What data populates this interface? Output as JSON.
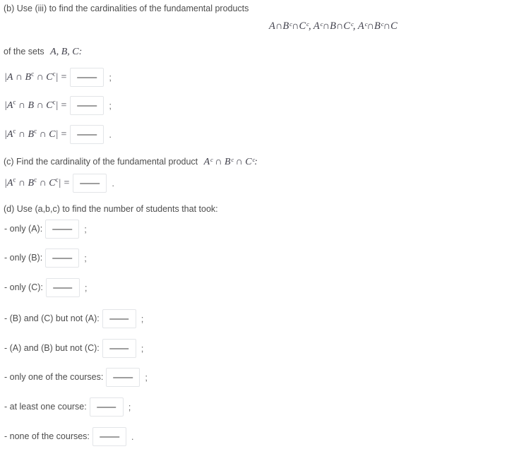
{
  "question_b": {
    "prompt": "(b) Use (iii) to find the cardinalities of the fundamental products",
    "products_expression": "A∩Bᶜ∩Cᶜ, Aᶜ∩B∩Cᶜ, Aᶜ∩Bᶜ∩C",
    "of_the_sets": "of the sets",
    "sets_list": "A, B, C:",
    "equals": "=",
    "blank_value": "",
    "blank_placeholder": "",
    "rows": [
      {
        "id": "A-Bc-Cc",
        "left_bar": "|",
        "term1": "A",
        "term1_sup": "",
        "term2": "B",
        "term2_sup": "c",
        "term3": "C",
        "term3_sup": "c",
        "right_bar": "|",
        "terminator": ";"
      },
      {
        "id": "Ac-B-Cc",
        "left_bar": "|",
        "term1": "A",
        "term1_sup": "c",
        "term2": "B",
        "term2_sup": "",
        "term3": "C",
        "term3_sup": "c",
        "right_bar": "|",
        "terminator": ";"
      },
      {
        "id": "Ac-Bc-C",
        "left_bar": "|",
        "term1": "A",
        "term1_sup": "c",
        "term2": "B",
        "term2_sup": "c",
        "term3": "C",
        "term3_sup": "",
        "right_bar": "|",
        "terminator": "."
      }
    ]
  },
  "question_c": {
    "prompt_prefix": "(c) Find the cardinality of the fundamental product",
    "prompt_math": "Aᶜ ∩ Bᶜ ∩ Cᶜ:",
    "row": {
      "id": "Ac-Bc-Cc",
      "left_bar": "|",
      "term1": "A",
      "term1_sup": "c",
      "term2": "B",
      "term2_sup": "c",
      "term3": "C",
      "term3_sup": "c",
      "right_bar": "|",
      "equals": "=",
      "terminator": "."
    },
    "blank_value": ""
  },
  "question_d": {
    "prompt": "(d) Use (a,b,c) to find the number of students that took:",
    "items": [
      {
        "label": "- only (A):",
        "terminator": ";",
        "value": ""
      },
      {
        "label": "- only (B):",
        "terminator": ";",
        "value": ""
      },
      {
        "label": "- only (C):",
        "terminator": ";",
        "value": ""
      },
      {
        "label": "- (B) and (C) but not (A):",
        "terminator": ";",
        "value": ""
      },
      {
        "label": "- (A) and (B) but not (C):",
        "terminator": ";",
        "value": ""
      },
      {
        "label": "- only one of the courses:",
        "terminator": ";",
        "value": ""
      },
      {
        "label": "- at least one course:",
        "terminator": ";",
        "value": ""
      },
      {
        "label": "- none of the courses:",
        "terminator": ".",
        "value": ""
      }
    ]
  },
  "symbols": {
    "intersection": "∩",
    "complement": "c",
    "bar": "|"
  },
  "colors": {
    "page_background": "#ffffff",
    "body_text": "#4d4d4d",
    "math_text": "#3f3f4a",
    "input_border": "#e3e5e8",
    "blank_rule": "#3d3d3d"
  }
}
